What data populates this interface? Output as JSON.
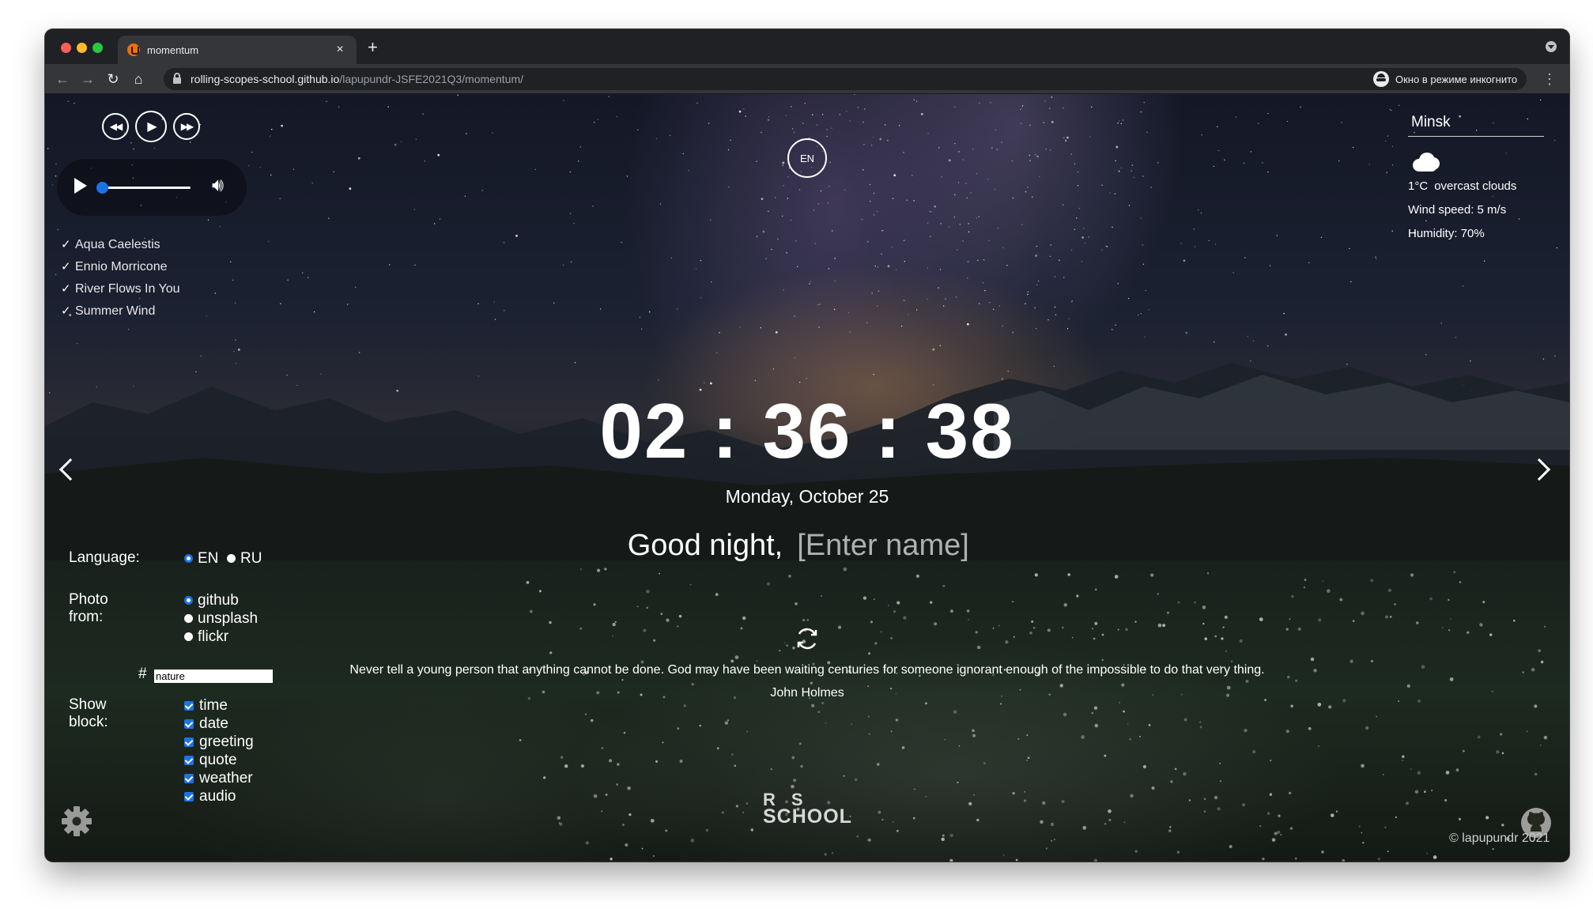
{
  "browser": {
    "tab_title": "momentum",
    "tab_close": "×",
    "new_tab": "+",
    "url_host": "rolling-scopes-school.github.io",
    "url_path": "/lapupundr-JSFE2021Q3/momentum/",
    "incognito_label": "Окно в режиме инкогнито",
    "icons": [
      "back-icon",
      "forward-icon",
      "reload-icon",
      "home-icon",
      "lock-icon",
      "bookmark-star-icon",
      "incognito-icon",
      "kebab-menu-icon",
      "tab-search-icon"
    ]
  },
  "player": {
    "playlist": [
      "Aqua Caelestis",
      "Ennio Morricone",
      "River Flows In You",
      "Summer Wind"
    ],
    "progress": 0.0,
    "check_glyph": "✓",
    "icons": [
      "prev-icon",
      "play-icon",
      "next-icon",
      "volume-icon"
    ]
  },
  "language_toggle": "EN",
  "weather": {
    "city": "Minsk",
    "temperature": "1°C",
    "description": "overcast clouds",
    "wind": "Wind speed: 5 m/s",
    "humidity": "Humidity: 70%",
    "icon": "cloud-icon"
  },
  "clock": {
    "time": "02 : 36 : 38",
    "date": "Monday, October 25"
  },
  "greeting": {
    "text": "Good night,",
    "name_placeholder": "[Enter name]",
    "name_value": ""
  },
  "settings": {
    "language_label": "Language:",
    "language_options": [
      "EN",
      "RU"
    ],
    "language_selected": "EN",
    "photo_label": "Photo from:",
    "photo_options": [
      "github",
      "unsplash",
      "flickr"
    ],
    "photo_selected": "github",
    "tag_prefix": "#",
    "tag_value": "nature",
    "show_label": "Show block:",
    "blocks": [
      "time",
      "date",
      "greeting",
      "quote",
      "weather",
      "audio"
    ],
    "blocks_checked": [
      true,
      true,
      true,
      true,
      true,
      true
    ]
  },
  "quote": {
    "text": "Never tell a young person that anything cannot be done. God may have been waiting centuries for someone ignorant enough of the impossible to do that very thing.",
    "author": "John Holmes"
  },
  "footer": {
    "logo_top": "RS",
    "logo_bottom": "SCHOOL",
    "copyright": "© lapupundr 2021"
  },
  "colors": {
    "accent": "#1a73e8",
    "chrome_dark": "#202124",
    "chrome_toolbar": "#35363a"
  }
}
